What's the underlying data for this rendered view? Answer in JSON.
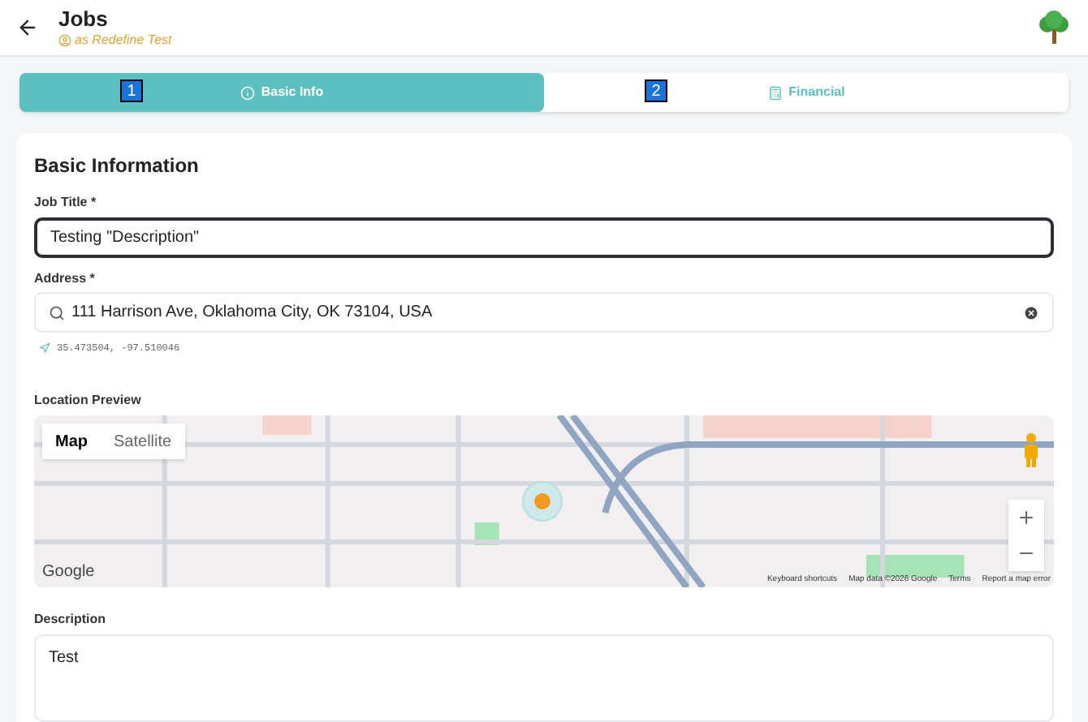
{
  "header": {
    "title": "Jobs",
    "subtitle": "as Redefine Test"
  },
  "steps": [
    {
      "number": "1",
      "label": "Basic Info",
      "selected": true
    },
    {
      "number": "2",
      "label": "Financial",
      "selected": false
    }
  ],
  "form": {
    "heading": "Basic Information",
    "job_title": {
      "label": "Job Title *",
      "value": "Testing \"Description\"",
      "focused": true
    },
    "address": {
      "label": "Address *",
      "value": "111 Harrison Ave, Oklahoma City, OK 73104, USA",
      "coordinates": "35.473504, -97.510046"
    },
    "location_preview": {
      "label": "Location Preview",
      "map_types": [
        {
          "label": "Map",
          "selected": true
        },
        {
          "label": "Satellite",
          "selected": false
        }
      ],
      "logo": "Google",
      "footer_links": [
        "Keyboard shortcuts",
        "Map data ©2026 Google",
        "Terms",
        "Report a map error"
      ]
    },
    "description": {
      "label": "Description",
      "value": "Test"
    }
  }
}
